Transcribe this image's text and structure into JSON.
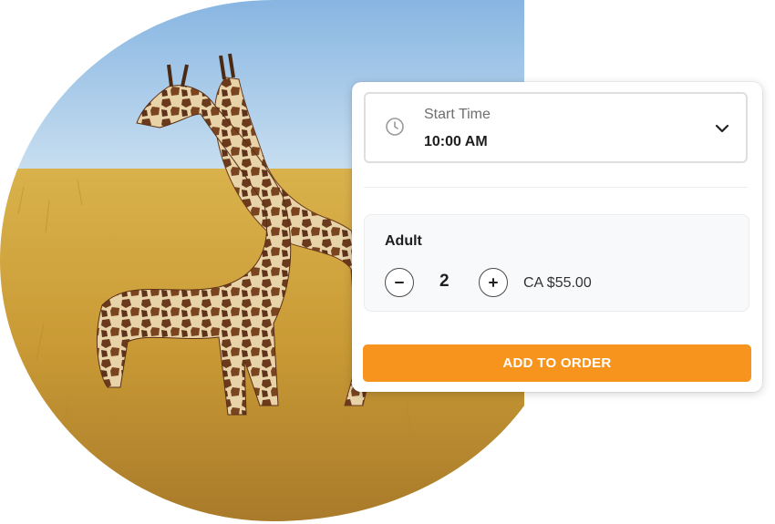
{
  "hero": {
    "image": "giraffes-savanna-photo"
  },
  "booking": {
    "start_time_label": "Start Time",
    "start_time_value": "10:00 AM",
    "ticket_type": "Adult",
    "quantity": "2",
    "price": "CA $55.00",
    "add_button_label": "ADD TO ORDER"
  },
  "icons": {
    "time": "clock-icon",
    "dropdown": "chevron-down-icon",
    "decrement": "minus-icon",
    "increment": "plus-icon"
  },
  "colors": {
    "accent": "#f7941d",
    "sky": "#9cc3e6",
    "grass": "#c9a13a"
  }
}
